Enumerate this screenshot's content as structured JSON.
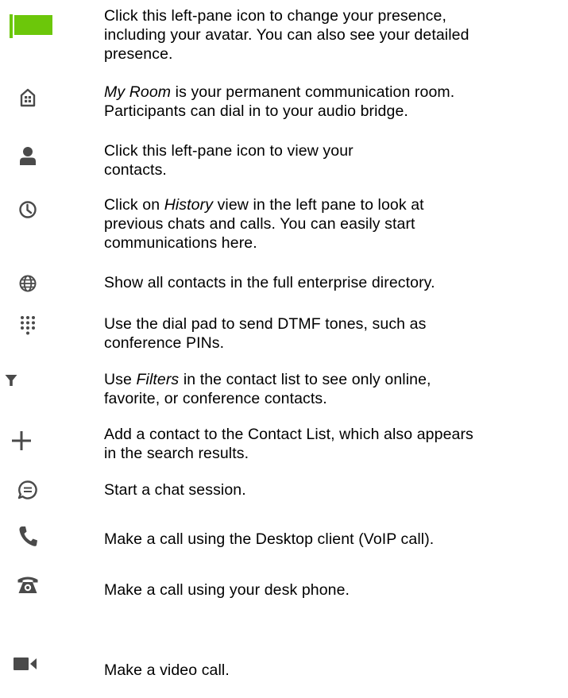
{
  "colors": {
    "flag": "#6cc70a",
    "icon": "#4a4a4a",
    "text": "#000000"
  },
  "rows": [
    {
      "icon": "green-flag-icon",
      "lines": [
        "Click this left-pane icon to change your presence,",
        "including your avatar.  You can also see your detailed",
        "presence."
      ]
    },
    {
      "icon": "my-room-icon",
      "em": "My Room",
      "lines": [
        " is your permanent communication room.",
        "Participants can dial in to your audio bridge."
      ]
    },
    {
      "icon": "contacts-person-icon",
      "lines": [
        "Click this left-pane icon to view your",
        "contacts."
      ]
    },
    {
      "icon": "history-clock-icon",
      "pre": "Click on ",
      "em": "History",
      "lines": [
        " view in the left pane to look at",
        "previous chats and calls.  You can easily start",
        "communications here."
      ]
    },
    {
      "icon": "globe-directory-icon",
      "lines": [
        "Show all contacts in the full enterprise directory."
      ]
    },
    {
      "icon": "dialpad-icon",
      "lines": [
        "Use the dial pad to send DTMF tones, such as",
        "conference PINs."
      ]
    },
    {
      "icon": "filter-funnel-icon",
      "pre": "Use ",
      "em": "Filters",
      "lines": [
        " in the contact list to see only online,",
        "favorite, or conference contacts."
      ]
    },
    {
      "icon": "add-plus-icon",
      "lines": [
        "Add a contact to the Contact List, which also appears",
        "in the search results."
      ]
    },
    {
      "icon": "chat-bubble-icon",
      "lines": [
        "Start a chat session."
      ]
    },
    {
      "icon": "voip-handset-icon",
      "lines": [
        "Make a call using the Desktop client (VoIP call)."
      ]
    },
    {
      "icon": "desk-phone-icon",
      "lines": [
        "Make a call using your desk phone."
      ]
    },
    {
      "icon": "video-camera-icon",
      "lines": [
        "Make a video call."
      ]
    }
  ]
}
